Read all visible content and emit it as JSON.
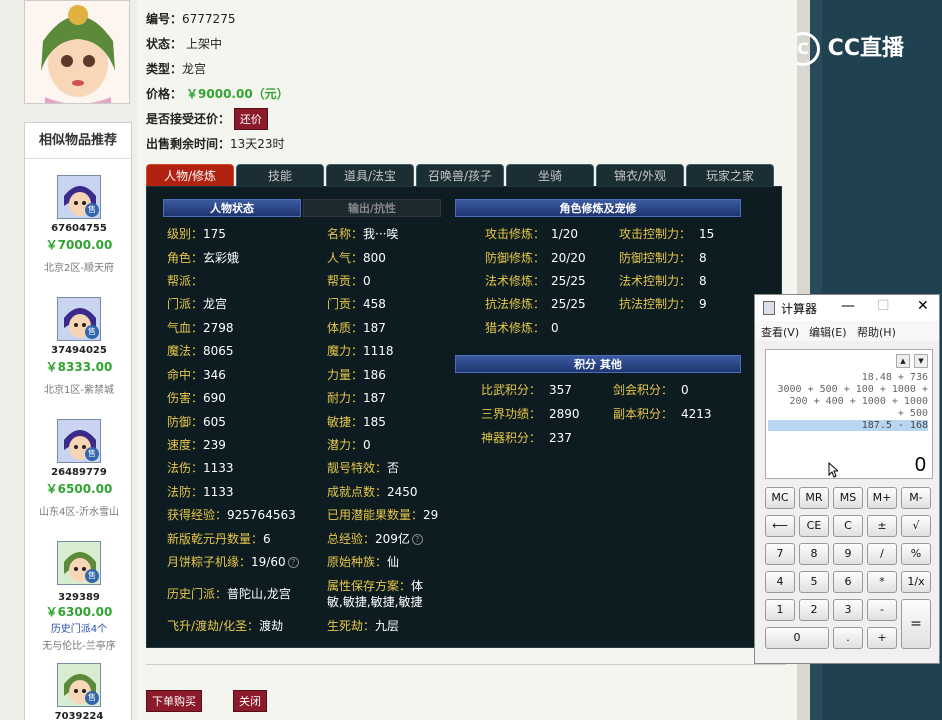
{
  "item": {
    "id_label": "编号：",
    "id_value": "6777275",
    "status_label": "状态：",
    "status_value": "上架中",
    "type_label": "类型：",
    "type_value": "龙宫",
    "price_label": "价格：",
    "price_value": "￥9000.00（元）",
    "bargain_label": "是否接受还价：",
    "bargain_button": "还价",
    "remaining_label": "出售剩余时间：",
    "remaining_value": "13天23时"
  },
  "similar": {
    "title": "相似物品推荐",
    "sell_badge": "售",
    "items": [
      {
        "id": "67604755",
        "price": "￥7000.00",
        "server": "北京2区-顺天府"
      },
      {
        "id": "37494025",
        "price": "￥8333.00",
        "server": "北京1区-紫禁城"
      },
      {
        "id": "26489779",
        "price": "￥6500.00",
        "server": "山东4区-沂水雪山"
      },
      {
        "id": "329389",
        "price": "￥6300.00",
        "extra": "历史门派4个",
        "server": "无与伦比-兰亭序"
      },
      {
        "id": "7039224",
        "price": "",
        "server": ""
      }
    ]
  },
  "tabs": [
    "人物/修炼",
    "技能",
    "道具/法宝",
    "召唤兽/孩子",
    "坐骑",
    "锦衣/外观",
    "玩家之家"
  ],
  "panel": {
    "hdr_status": "人物状态",
    "hdr_output": "输出/抗性",
    "hdr_cultivation": "角色修炼及宠修",
    "hdr_points": "积分 其他",
    "col1": [
      {
        "k": "级别：",
        "v": "175"
      },
      {
        "k": "角色：",
        "v": "玄彩娥"
      },
      {
        "k": "帮派：",
        "v": ""
      },
      {
        "k": "门派：",
        "v": "龙宫"
      },
      {
        "k": "气血：",
        "v": "2798"
      },
      {
        "k": "魔法：",
        "v": "8065"
      },
      {
        "k": "命中：",
        "v": "346"
      },
      {
        "k": "伤害：",
        "v": "690"
      },
      {
        "k": "防御：",
        "v": "605"
      },
      {
        "k": "速度：",
        "v": "239"
      },
      {
        "k": "法伤：",
        "v": "1133"
      },
      {
        "k": "法防：",
        "v": "1133"
      },
      {
        "k": "获得经验：",
        "v": "925764563"
      },
      {
        "k": "新版乾元丹数量：",
        "v": "6"
      },
      {
        "k": "月饼粽子机缘：",
        "v": "19/60"
      }
    ],
    "col2": [
      {
        "k": "名称：",
        "v": "我···唉"
      },
      {
        "k": "人气：",
        "v": "800"
      },
      {
        "k": "帮贡：",
        "v": "0"
      },
      {
        "k": "门贡：",
        "v": "458"
      },
      {
        "k": "体质：",
        "v": "187"
      },
      {
        "k": "魔力：",
        "v": "1118"
      },
      {
        "k": "力量：",
        "v": "186"
      },
      {
        "k": "耐力：",
        "v": "187"
      },
      {
        "k": "敏捷：",
        "v": "185"
      },
      {
        "k": "潜力：",
        "v": "0"
      },
      {
        "k": "靓号特效：",
        "v": "否"
      },
      {
        "k": "成就点数：",
        "v": "2450"
      },
      {
        "k": "已用潜能果数量：",
        "v": "29"
      },
      {
        "k": "总经验：",
        "v": "209亿"
      },
      {
        "k": "原始种族：",
        "v": "仙"
      }
    ],
    "history_label": "历史门派：",
    "history_value": "普陀山,龙宫",
    "attr_label": "属性保存方案：",
    "attr_value1": "体",
    "attr_value2": "敏,敏捷,敏捷,敏捷",
    "fly_label": "飞升/渡劫/化圣：",
    "fly_value": "渡劫",
    "life_label": "生死劫：",
    "life_value": "九层",
    "cult_left": [
      {
        "k": "攻击修炼：",
        "v": "1/20"
      },
      {
        "k": "防御修炼：",
        "v": "20/20"
      },
      {
        "k": "法术修炼：",
        "v": "25/25"
      },
      {
        "k": "抗法修炼：",
        "v": "25/25"
      },
      {
        "k": "猎术修炼：",
        "v": "0"
      }
    ],
    "cult_right": [
      {
        "k": "攻击控制力：",
        "v": "15"
      },
      {
        "k": "防御控制力：",
        "v": "8"
      },
      {
        "k": "法术控制力：",
        "v": "8"
      },
      {
        "k": "抗法控制力：",
        "v": "9"
      }
    ],
    "points_left": [
      {
        "k": "比武积分：",
        "v": "357"
      },
      {
        "k": "三界功绩：",
        "v": "2890"
      },
      {
        "k": "神器积分：",
        "v": "237"
      }
    ],
    "points_right": [
      {
        "k": "剑会积分：",
        "v": "0"
      },
      {
        "k": "副本积分：",
        "v": "4213"
      }
    ]
  },
  "buttons": {
    "buy": "下单购买",
    "close": "关闭"
  },
  "logo": {
    "text": "CC直播",
    "mark": "C"
  },
  "calculator": {
    "title": "计算器",
    "menu": [
      "查看(V)",
      "编辑(E)",
      "帮助(H)"
    ],
    "minimize": "—",
    "maximize": "☐",
    "close": "✕",
    "history": [
      "18.48 + 736",
      "3000 + 500 + 100 + 1000 +",
      "200 + 400 + 1000 + 1000",
      "+ 500",
      "187.5 - 168"
    ],
    "result": "0",
    "keys": [
      [
        "MC",
        "MR",
        "MS",
        "M+",
        "M-"
      ],
      [
        "⟵",
        "CE",
        "C",
        "±",
        "√"
      ],
      [
        "7",
        "8",
        "9",
        "/",
        "%"
      ],
      [
        "4",
        "5",
        "6",
        "*",
        "1/x"
      ],
      [
        "1",
        "2",
        "3",
        "-",
        "="
      ],
      [
        "0",
        ".",
        "+"
      ]
    ]
  },
  "colors": {
    "accent_red": "#8b1a2a",
    "price_green": "#2fa42f",
    "panel_bg": "#0c1c20",
    "label_yellow": "#e8c64a"
  }
}
